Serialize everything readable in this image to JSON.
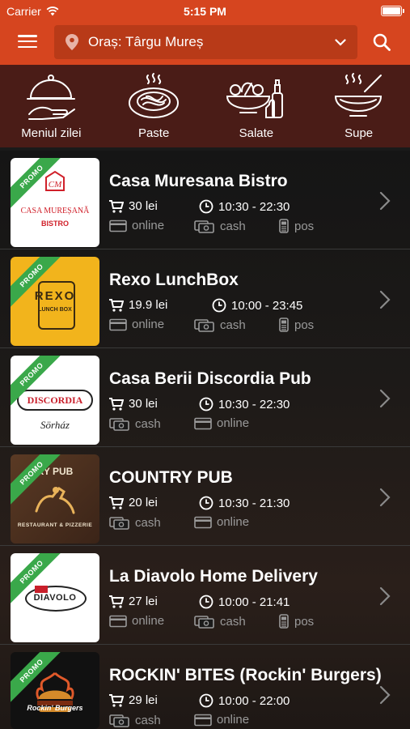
{
  "status": {
    "carrier": "Carrier",
    "time": "5:15 PM"
  },
  "header": {
    "city_label": "Oraș: Târgu Mureș"
  },
  "categories": [
    {
      "label": "Meniul zilei",
      "icon": "cloche-icon"
    },
    {
      "label": "Paste",
      "icon": "pasta-icon"
    },
    {
      "label": "Salate",
      "icon": "salad-icon"
    },
    {
      "label": "Supe",
      "icon": "soup-icon"
    }
  ],
  "promo_label": "PROMO",
  "colors": {
    "accent": "#d6451f",
    "category_bar": "#4a1c17",
    "promo": "#3aa84a"
  },
  "restaurants": [
    {
      "name": "Casa Muresana Bistro",
      "min_order": "30 lei",
      "hours": "10:30 - 22:30",
      "payments": [
        "online",
        "cash",
        "pos"
      ],
      "logo": "casa-muresana-logo",
      "logo_text": [
        "CASA MUREȘANĂ",
        "BISTRO"
      ]
    },
    {
      "name": "Rexo LunchBox",
      "min_order": "19.9 lei",
      "hours": "10:00 - 23:45",
      "payments": [
        "online",
        "cash",
        "pos"
      ],
      "logo": "rexo-logo",
      "logo_text": [
        "REXO",
        "LUNCH BOX"
      ]
    },
    {
      "name": "Casa Berii Discordia Pub",
      "min_order": "30 lei",
      "hours": "10:30 - 22:30",
      "payments": [
        "cash",
        "online"
      ],
      "logo": "discordia-logo",
      "logo_text": [
        "DISCORDIA",
        "Sörház"
      ]
    },
    {
      "name": "COUNTRY PUB",
      "min_order": "20 lei",
      "hours": "10:30 - 21:30",
      "payments": [
        "cash",
        "online"
      ],
      "logo": "country-pub-logo",
      "logo_text": [
        "RY PUB",
        "RESTAURANT & PIZZERIE"
      ]
    },
    {
      "name": "La Diavolo Home Delivery",
      "min_order": "27 lei",
      "hours": "10:00 - 21:41",
      "payments": [
        "online",
        "cash",
        "pos"
      ],
      "logo": "la-diavolo-logo",
      "logo_text": [
        "DIAVOLO"
      ]
    },
    {
      "name": "ROCKIN' BITES (Rockin' Burgers)",
      "min_order": "29 lei",
      "hours": "10:00 - 22:00",
      "payments": [
        "cash",
        "online"
      ],
      "logo": "rockin-bites-logo",
      "logo_text": [
        "Rockin' Burgers"
      ]
    }
  ]
}
